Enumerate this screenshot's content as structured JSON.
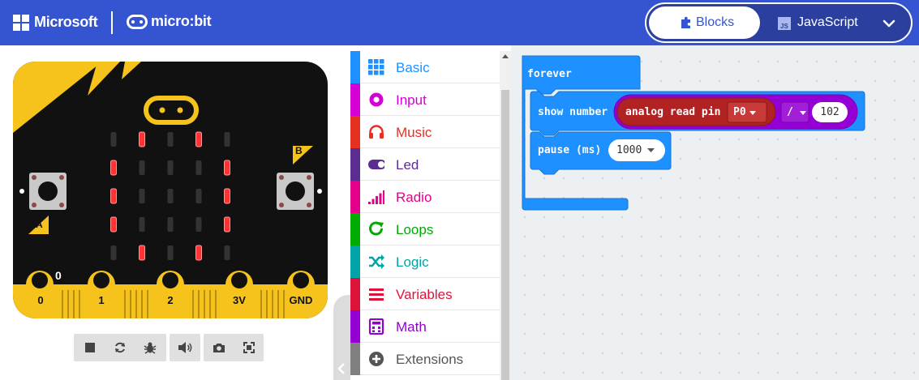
{
  "header": {
    "brand": "Microsoft",
    "product": "micro:bit",
    "modes": {
      "blocks_label": "Blocks",
      "javascript_label": "JavaScript"
    }
  },
  "simulator": {
    "buttons": {
      "a_label": "A",
      "b_label": "B"
    },
    "pins": [
      "0",
      "1",
      "2",
      "3V",
      "GND"
    ],
    "pin_value": "0",
    "led_on": [
      [
        0,
        1,
        0,
        1,
        0
      ],
      [
        1,
        0,
        0,
        0,
        1
      ],
      [
        1,
        0,
        0,
        0,
        1
      ],
      [
        1,
        0,
        0,
        0,
        1
      ],
      [
        0,
        1,
        0,
        1,
        0
      ]
    ]
  },
  "toolbox": {
    "items": [
      {
        "label": "Basic",
        "color": "#1e90ff",
        "icon": "grid-icon"
      },
      {
        "label": "Input",
        "color": "#d400d4",
        "icon": "input-target-icon"
      },
      {
        "label": "Music",
        "color": "#e63022",
        "icon": "headphones-icon"
      },
      {
        "label": "Led",
        "color": "#5c2d91",
        "icon": "toggle-icon"
      },
      {
        "label": "Radio",
        "color": "#e3008c",
        "icon": "signal-bars-icon"
      },
      {
        "label": "Loops",
        "color": "#00aa00",
        "icon": "loop-arrow-icon"
      },
      {
        "label": "Logic",
        "color": "#00a4a6",
        "icon": "shuffle-icon"
      },
      {
        "label": "Variables",
        "color": "#dc143c",
        "icon": "list-lines-icon"
      },
      {
        "label": "Math",
        "color": "#9400d3",
        "icon": "calculator-icon"
      },
      {
        "label": "Extensions",
        "color": "#808080",
        "icon": "plus-circle-icon"
      }
    ]
  },
  "workspace": {
    "forever_label": "forever",
    "show_number_label": "show number",
    "analog_read_label": "analog read pin",
    "pin_label": "P0",
    "divide_op": "/",
    "divisor": "102",
    "pause_label": "pause (ms)",
    "pause_value": "1000"
  },
  "colors": {
    "header": "#3454d1",
    "basic_block": "#1e90ff",
    "pins_block": "#b22222",
    "math_block": "#9400d3",
    "led_on": "#ff3333"
  }
}
